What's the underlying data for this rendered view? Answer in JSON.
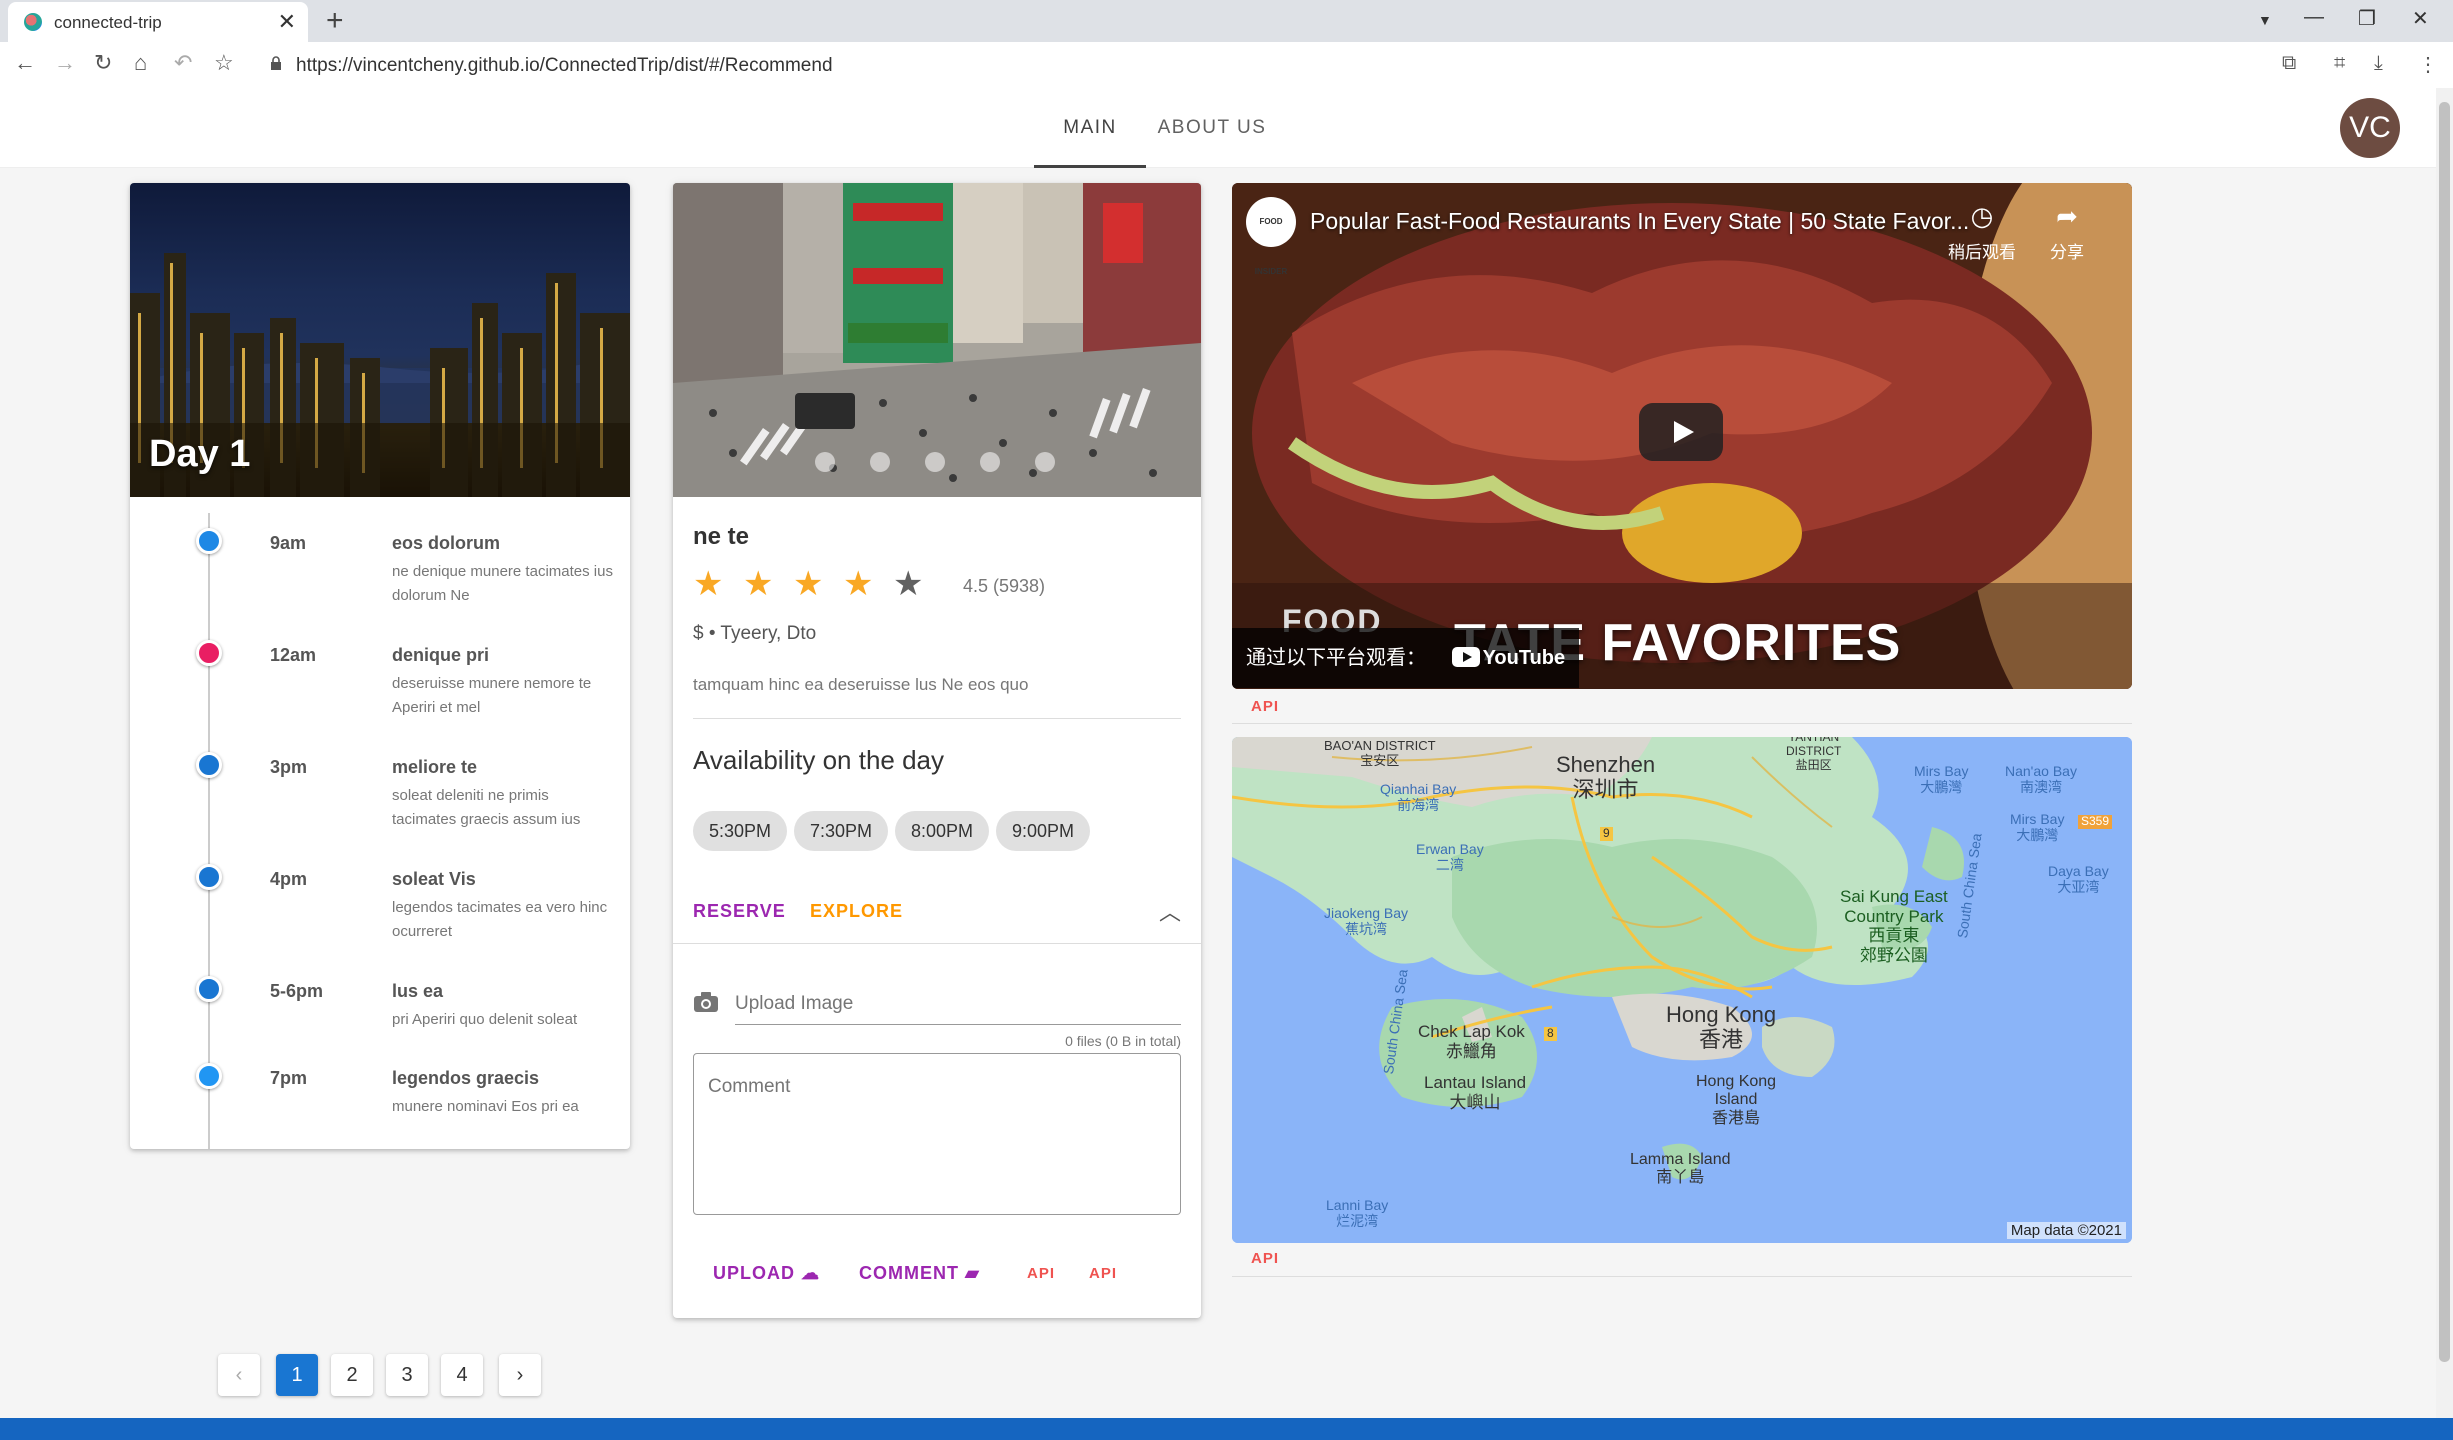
{
  "browser": {
    "tab_title": "connected-trip",
    "new_tab": "+",
    "close": "✕",
    "url": "https://vincentcheny.github.io/ConnectedTrip/dist/#/Recommend"
  },
  "appbar": {
    "tabs": [
      {
        "label": "MAIN"
      },
      {
        "label": "ABOUT US"
      }
    ],
    "avatar": "VC"
  },
  "day_card": {
    "title": "Day 1",
    "items": [
      {
        "time": "9am",
        "title": "eos dolorum",
        "desc": "ne denique munere tacimates ius dolorum Ne",
        "color": "#1e88e5"
      },
      {
        "time": "12am",
        "title": "denique pri",
        "desc": "deseruisse munere nemore te Aperiri et mel",
        "color": "#e91e63"
      },
      {
        "time": "3pm",
        "title": "meliore te",
        "desc": "soleat deleniti ne primis tacimates graecis assum ius",
        "color": "#1976d2"
      },
      {
        "time": "4pm",
        "title": "soleat Vis",
        "desc": "legendos tacimates ea vero hinc ocurreret",
        "color": "#1976d2"
      },
      {
        "time": "5-6pm",
        "title": "lus ea",
        "desc": "pri Aperiri quo delenit soleat",
        "color": "#1976d2"
      },
      {
        "time": "7pm",
        "title": "legendos graecis",
        "desc": "munere nominavi Eos pri ea",
        "color": "#2196f3"
      }
    ]
  },
  "restaurant": {
    "name": "ne te",
    "rating": 4.5,
    "rating_text": "4.5 (5938)",
    "price_location": "$ • Tyeery, Dto",
    "description": "tamquam hinc ea deseruisse lus Ne eos quo",
    "availability_title": "Availability on the day",
    "times": [
      "5:30PM",
      "7:30PM",
      "8:00PM",
      "9:00PM"
    ],
    "actions": {
      "reserve": "RESERVE",
      "explore": "EXPLORE"
    },
    "upload_placeholder": "Upload Image",
    "files_info": "0 files (0 B in total)",
    "comment_placeholder": "Comment",
    "bottom": {
      "upload": "UPLOAD",
      "comment": "COMMENT",
      "api1": "API",
      "api2": "API"
    },
    "colors": {
      "accent": "#9c27b0",
      "explore": "#ff9800",
      "star": "#f9a825",
      "api": "#ef5350"
    }
  },
  "video": {
    "title": "Popular Fast-Food Restaurants In Every State | 50 State Favor...",
    "channel": "FOOD INSIDER",
    "watch_later": "稍后观看",
    "share": "分享",
    "watch_on": "通过以下平台观看：",
    "youtube": "YouTube",
    "overlay": "TATE FAVORITES",
    "food": "FOOD"
  },
  "api_labels": {
    "video": "API",
    "map": "API"
  },
  "map": {
    "attribution": "Map data ©2021",
    "labels": [
      {
        "text": "BAO'AN DISTRICT\n宝安区",
        "cls": "small"
      },
      {
        "text": "Shenzhen\n深圳市",
        "cls": "big"
      },
      {
        "text": "YANTIAN\nDISTRICT\n盐田区",
        "cls": "small"
      },
      {
        "text": "Mirs Bay\n大鵬灣",
        "cls": "water"
      },
      {
        "text": "Nan'ao Bay\n南澳湾",
        "cls": "water"
      },
      {
        "text": "Qianhai Bay\n前海湾",
        "cls": "water"
      },
      {
        "text": "Mirs Bay\n大鵬灣",
        "cls": "water"
      },
      {
        "text": "Erwan Bay\n二湾",
        "cls": "water"
      },
      {
        "text": "Daya Bay\n大亚湾",
        "cls": "water"
      },
      {
        "text": "Jiaokeng Bay\n蕉坑湾",
        "cls": "water"
      },
      {
        "text": "Sai Kung East\nCountry Park\n西貢東\n郊野公園",
        "cls": "green"
      },
      {
        "text": "South China Sea",
        "cls": "water"
      },
      {
        "text": "South China Sea",
        "cls": "water"
      },
      {
        "text": "Hong Kong\n香港",
        "cls": "big"
      },
      {
        "text": "Chek Lap Kok\n赤鱲角",
        "cls": "mid"
      },
      {
        "text": "Lantau Island\n大嶼山",
        "cls": "mid"
      },
      {
        "text": "Hong Kong\nIsland\n香港島",
        "cls": "mid"
      },
      {
        "text": "Lamma Island\n南丫島",
        "cls": "mid"
      },
      {
        "text": "Lanni Bay\n烂泥湾",
        "cls": "water"
      }
    ],
    "road_badges": [
      "S359",
      "9",
      "8"
    ]
  },
  "pagination": {
    "pages": [
      "1",
      "2",
      "3",
      "4"
    ],
    "active": "1",
    "prev": "‹",
    "next": "›"
  }
}
